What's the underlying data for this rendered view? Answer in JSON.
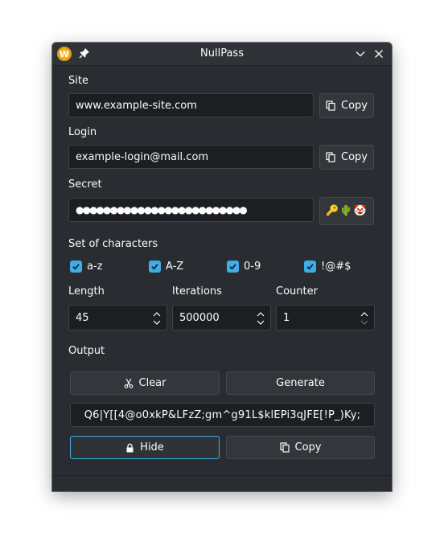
{
  "window": {
    "title": "NullPass",
    "app_icon_letter": "W"
  },
  "site": {
    "label": "Site",
    "value": "www.example-site.com",
    "copy_label": "Copy"
  },
  "login": {
    "label": "Login",
    "value": "example-login@mail.com",
    "copy_label": "Copy"
  },
  "secret": {
    "label": "Secret",
    "value": "●●●●●●●●●●●●●●●●●●●●●●●●●",
    "emoji": "🔑🌵🤡"
  },
  "charset": {
    "label": "Set of characters",
    "options": [
      {
        "label": "a-z",
        "checked": true
      },
      {
        "label": "A-Z",
        "checked": true
      },
      {
        "label": "0-9",
        "checked": true
      },
      {
        "label": "!@#$",
        "checked": true
      }
    ]
  },
  "length": {
    "label": "Length",
    "value": "45"
  },
  "iterations": {
    "label": "Iterations",
    "value": "500000"
  },
  "counter": {
    "label": "Counter",
    "value": "1"
  },
  "output": {
    "label": "Output",
    "clear_label": "Clear",
    "generate_label": "Generate",
    "password": "Q6|Y[[4@o0xkP&LFzZ;gm^g91L$klEPi3qJFE[!P_)Ky;",
    "hide_label": "Hide",
    "copy_label": "Copy"
  },
  "colors": {
    "window_bg": "#292c30",
    "field_bg": "#1c1e21",
    "accent": "#3daee9",
    "text": "#fcfcfc"
  }
}
